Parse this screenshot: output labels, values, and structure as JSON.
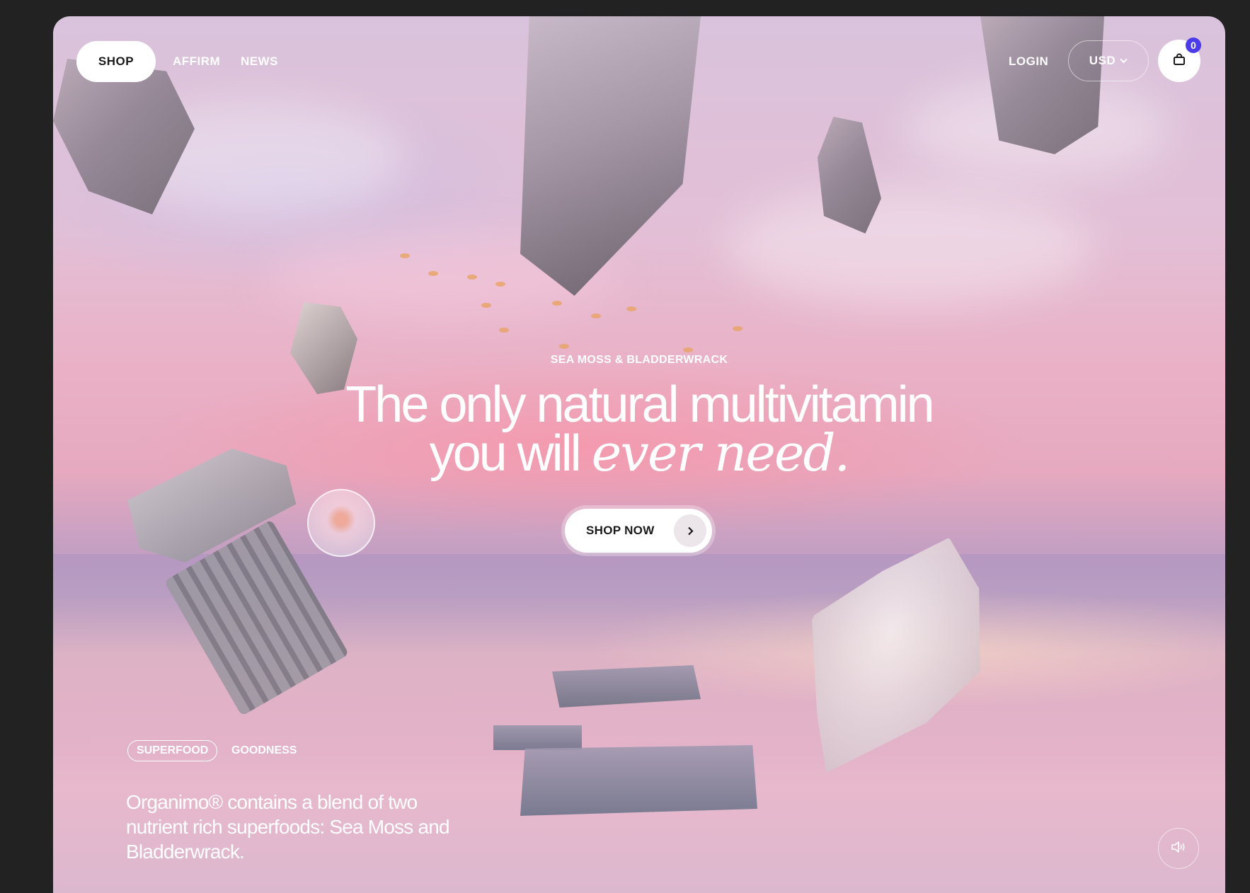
{
  "nav": {
    "shop_label": "SHOP",
    "affirm_label": "AFFIRM",
    "news_label": "NEWS",
    "login_label": "LOGIN",
    "currency_label": "USD",
    "currency_icon": "chevron-down-icon",
    "cart_icon": "shopping-bag-icon",
    "cart_count": "0",
    "cart_badge_color": "#4b3be8"
  },
  "hero": {
    "eyebrow": "SEA MOSS & BLADDERWRACK",
    "headline_line1": "The only natural multivitamin",
    "headline_line2_plain": "you will ",
    "headline_line2_italic": "ever need.",
    "cta_label": "SHOP NOW",
    "cta_icon": "chevron-right-icon"
  },
  "info": {
    "tag_outlined": "SUPERFOOD",
    "tag_plain": "GOODNESS",
    "body": "Organimo® contains a blend of two nutrient rich superfoods: Sea Moss and Bladderwrack."
  },
  "controls": {
    "sound_icon": "speaker-icon"
  }
}
